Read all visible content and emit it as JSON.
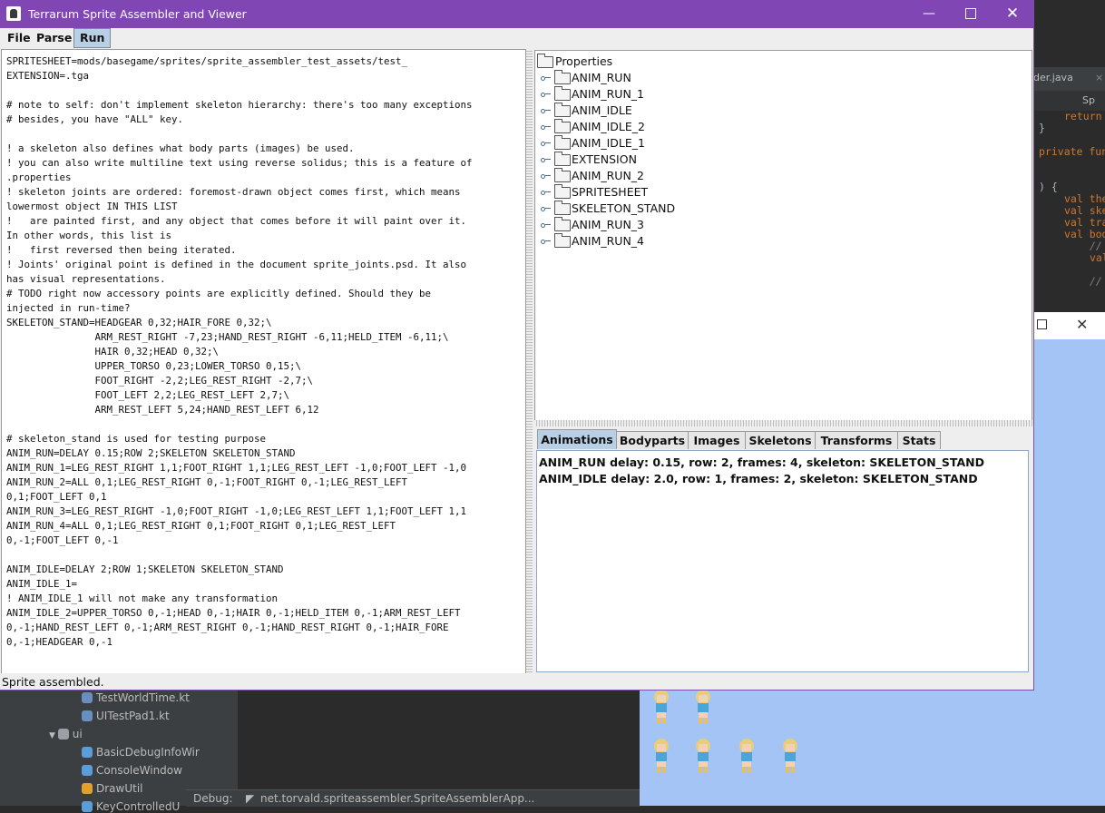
{
  "window": {
    "title": "Terrarum Sprite Assembler and Viewer",
    "colors": {
      "titlebar": "#8046b4",
      "menu_active": "#b8cfe5"
    }
  },
  "menubar": [
    "File",
    "Parse",
    "Run"
  ],
  "source_lines": [
    "SPRITESHEET=mods/basegame/sprites/sprite_assembler_test_assets/test_",
    "EXTENSION=.tga",
    "",
    "# note to self: don't implement skeleton hierarchy: there's too many exceptions",
    "# besides, you have \"ALL\" key.",
    "",
    "! a skeleton also defines what body parts (images) be used.",
    "! you can also write multiline text using reverse solidus; this is a feature of",
    ".properties",
    "! skeleton joints are ordered: foremost-drawn object comes first, which means",
    "lowermost object IN THIS LIST",
    "!   are painted first, and any object that comes before it will paint over it.",
    "In other words, this list is",
    "!   first reversed then being iterated.",
    "! Joints' original point is defined in the document sprite_joints.psd. It also",
    "has visual representations.",
    "# TODO right now accessory points are explicitly defined. Should they be",
    "injected in run-time?",
    "SKELETON_STAND=HEADGEAR 0,32;HAIR_FORE 0,32;\\",
    "               ARM_REST_RIGHT -7,23;HAND_REST_RIGHT -6,11;HELD_ITEM -6,11;\\",
    "               HAIR 0,32;HEAD 0,32;\\",
    "               UPPER_TORSO 0,23;LOWER_TORSO 0,15;\\",
    "               FOOT_RIGHT -2,2;LEG_REST_RIGHT -2,7;\\",
    "               FOOT_LEFT 2,2;LEG_REST_LEFT 2,7;\\",
    "               ARM_REST_LEFT 5,24;HAND_REST_LEFT 6,12",
    "",
    "# skeleton_stand is used for testing purpose",
    "ANIM_RUN=DELAY 0.15;ROW 2;SKELETON SKELETON_STAND",
    "ANIM_RUN_1=LEG_REST_RIGHT 1,1;FOOT_RIGHT 1,1;LEG_REST_LEFT -1,0;FOOT_LEFT -1,0",
    "ANIM_RUN_2=ALL 0,1;LEG_REST_RIGHT 0,-1;FOOT_RIGHT 0,-1;LEG_REST_LEFT",
    "0,1;FOOT_LEFT 0,1",
    "ANIM_RUN_3=LEG_REST_RIGHT -1,0;FOOT_RIGHT -1,0;LEG_REST_LEFT 1,1;FOOT_LEFT 1,1",
    "ANIM_RUN_4=ALL 0,1;LEG_REST_RIGHT 0,1;FOOT_RIGHT 0,1;LEG_REST_LEFT",
    "0,-1;FOOT_LEFT 0,-1",
    "",
    "ANIM_IDLE=DELAY 2;ROW 1;SKELETON SKELETON_STAND",
    "ANIM_IDLE_1=",
    "! ANIM_IDLE_1 will not make any transformation",
    "ANIM_IDLE_2=UPPER_TORSO 0,-1;HEAD 0,-1;HAIR 0,-1;HELD_ITEM 0,-1;ARM_REST_LEFT",
    "0,-1;HAND_REST_LEFT 0,-1;ARM_REST_RIGHT 0,-1;HAND_REST_RIGHT 0,-1;HAIR_FORE",
    "0,-1;HEADGEAR 0,-1"
  ],
  "tree": {
    "root": "Properties",
    "children": [
      "ANIM_RUN",
      "ANIM_RUN_1",
      "ANIM_IDLE",
      "ANIM_IDLE_2",
      "ANIM_IDLE_1",
      "EXTENSION",
      "ANIM_RUN_2",
      "SPRITESHEET",
      "SKELETON_STAND",
      "ANIM_RUN_3",
      "ANIM_RUN_4"
    ]
  },
  "tabs": [
    "Animations",
    "Bodyparts",
    "Images",
    "Skeletons",
    "Transforms",
    "Stats"
  ],
  "selected_tab": "Animations",
  "animations": [
    "ANIM_RUN delay: 0.15, row: 2, frames: 4, skeleton: SKELETON_STAND",
    "ANIM_IDLE delay: 2.0, row: 1, frames: 2, skeleton: SKELETON_STAND"
  ],
  "status": "Sprite assembled.",
  "ide": {
    "tab_label": "der.java",
    "tab2_label": "Sp",
    "code": [
      {
        "t": "return ",
        "c": "kw",
        "i": 1
      },
      {
        "t": "}",
        "c": "pl",
        "i": 0
      },
      {
        "t": "",
        "c": "pl",
        "i": 0
      },
      {
        "t": "private fun",
        "c": "kw",
        "i": 0
      },
      {
        "t": "",
        "c": "pl",
        "i": 0
      },
      {
        "t": "",
        "c": "pl",
        "i": 0
      },
      {
        "t": ") {",
        "c": "pl",
        "i": 0
      },
      {
        "t": "val the",
        "c": "kw",
        "i": 1
      },
      {
        "t": "val ske",
        "c": "kw",
        "i": 1
      },
      {
        "t": "val tra",
        "c": "kw",
        "i": 1
      },
      {
        "t": "val bod",
        "c": "kw",
        "i": 1
      },
      {
        "t": "//",
        "c": "cm",
        "i": 2
      },
      {
        "t": "val",
        "c": "kw",
        "i": 2
      },
      {
        "t": "",
        "c": "pl",
        "i": 0
      },
      {
        "t": "//",
        "c": "cm",
        "i": 2
      }
    ],
    "project_items": [
      {
        "label": "TestWorldTime.kt",
        "icon": "kotlin-file-icon"
      },
      {
        "label": "UITestPad1.kt",
        "icon": "kotlin-file-icon"
      },
      {
        "label": "ui",
        "icon": "package-icon"
      },
      {
        "label": "BasicDebugInfoWir",
        "icon": "class-icon"
      },
      {
        "label": "ConsoleWindow",
        "icon": "class-icon"
      },
      {
        "label": "DrawUtil",
        "icon": "object-icon"
      },
      {
        "label": "KeyControlledU",
        "icon": "class-icon"
      }
    ],
    "debug_label": "Debug:",
    "debug_config": "net.torvald.spriteassembler.SpriteAssemblerApp..."
  }
}
